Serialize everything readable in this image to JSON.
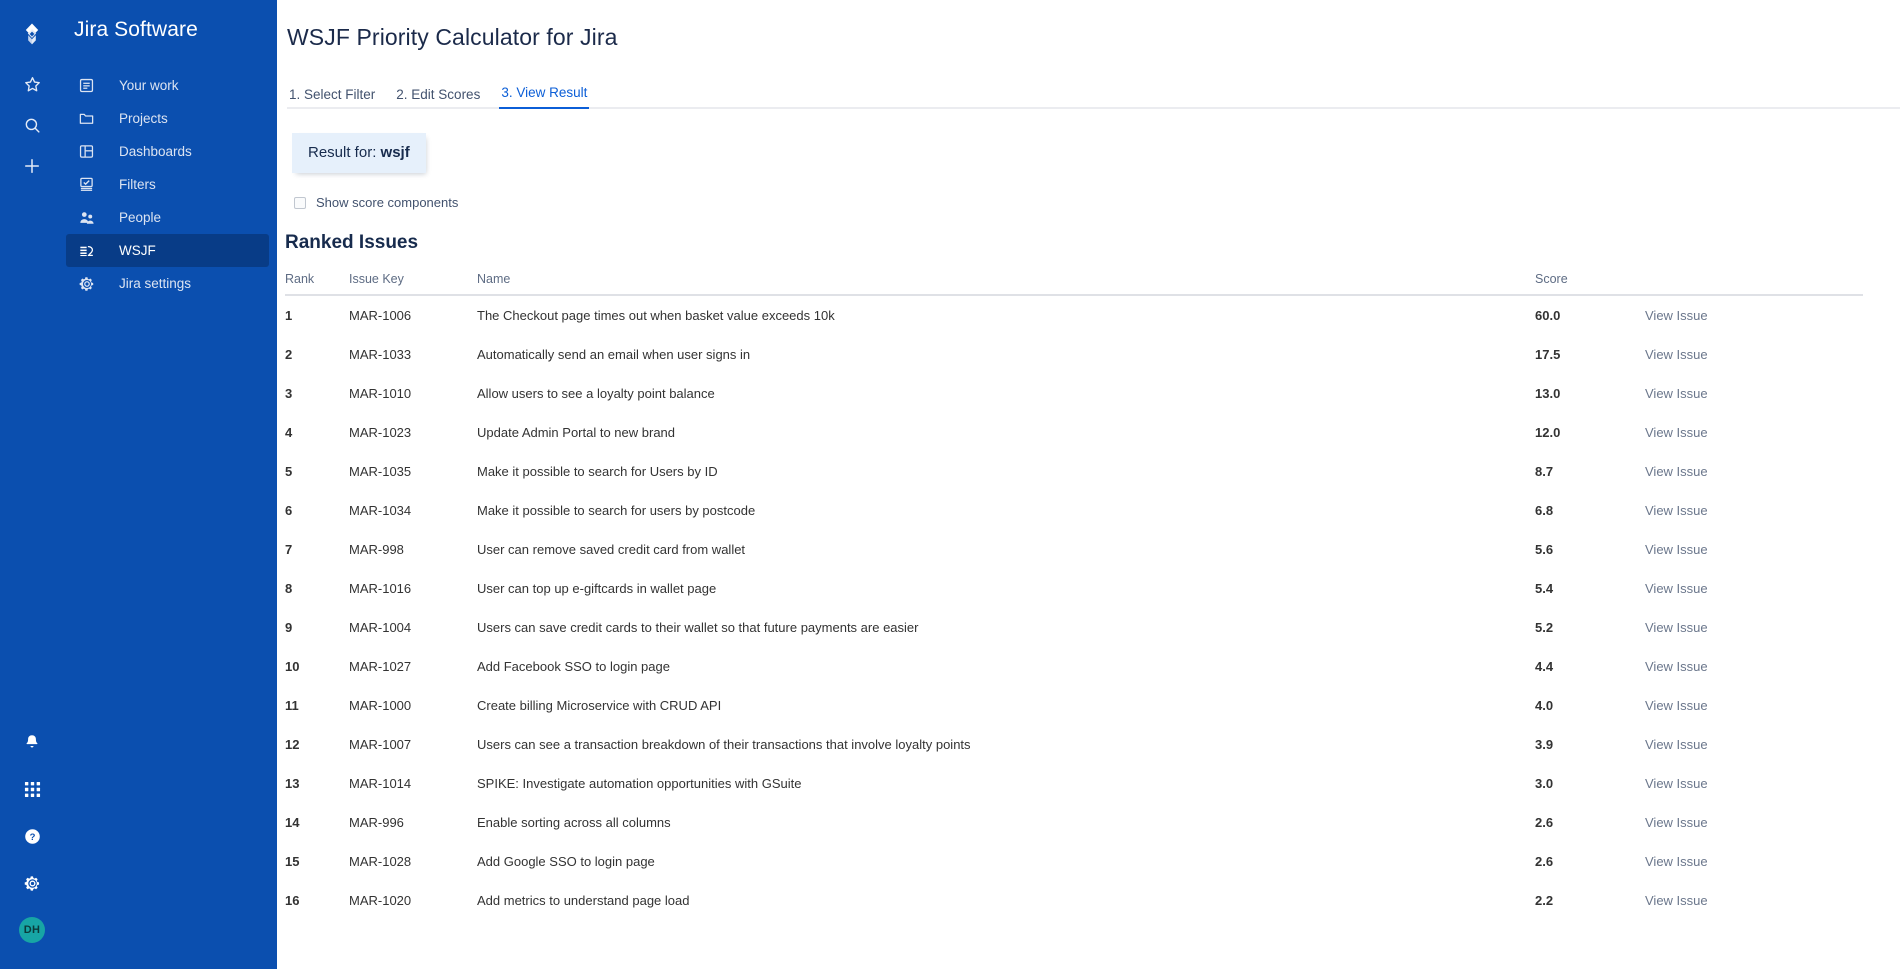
{
  "rail": {
    "icons": [
      {
        "name": "jira-logo-icon",
        "label": "Jira"
      },
      {
        "name": "star-icon",
        "label": "Starred"
      },
      {
        "name": "search-icon",
        "label": "Search"
      },
      {
        "name": "plus-icon",
        "label": "Create"
      }
    ],
    "bottom_icons": [
      {
        "name": "notification-bell-icon",
        "label": "Notifications"
      },
      {
        "name": "app-switcher-grid-icon",
        "label": "Apps"
      },
      {
        "name": "help-question-icon",
        "label": "Help"
      },
      {
        "name": "settings-gear-icon",
        "label": "Settings"
      }
    ],
    "avatar_initials": "DH",
    "avatar_color": "#17A5A5"
  },
  "sidebar": {
    "title": "Jira Software",
    "background_color": "#0B4FAF",
    "active_item_color": "#083C87",
    "items": [
      {
        "label": "Your work",
        "icon": "your-work-icon",
        "active": false
      },
      {
        "label": "Projects",
        "icon": "folder-icon",
        "active": false
      },
      {
        "label": "Dashboards",
        "icon": "dashboard-icon",
        "active": false
      },
      {
        "label": "Filters",
        "icon": "filters-icon",
        "active": false
      },
      {
        "label": "People",
        "icon": "people-icon",
        "active": false
      },
      {
        "label": "WSJF",
        "icon": "wsjf-icon",
        "active": true
      },
      {
        "label": "Jira settings",
        "icon": "settings-gear-icon",
        "active": false
      }
    ]
  },
  "header": {
    "title": "WSJF Priority Calculator for Jira"
  },
  "tabs": [
    {
      "label": "1. Select Filter",
      "active": false
    },
    {
      "label": "2. Edit Scores",
      "active": false
    },
    {
      "label": "3. View Result",
      "active": true
    }
  ],
  "result_chip": {
    "prefix": "Result for: ",
    "value": "wsjf",
    "background_color": "#E6F0FB"
  },
  "options": {
    "show_score_components_label": "Show score components",
    "show_score_components_checked": false
  },
  "table": {
    "section_title": "Ranked Issues",
    "headers": [
      "Rank",
      "Issue Key",
      "Name",
      "Score",
      ""
    ],
    "link_label": "View Issue",
    "rows": [
      {
        "rank": "1",
        "key": "MAR-1006",
        "name": "The Checkout page times out when basket value exceeds 10k",
        "score": "60.0"
      },
      {
        "rank": "2",
        "key": "MAR-1033",
        "name": "Automatically send an email when user signs in",
        "score": "17.5"
      },
      {
        "rank": "3",
        "key": "MAR-1010",
        "name": "Allow users to see a loyalty point balance",
        "score": "13.0"
      },
      {
        "rank": "4",
        "key": "MAR-1023",
        "name": "Update Admin Portal to new brand",
        "score": "12.0"
      },
      {
        "rank": "5",
        "key": "MAR-1035",
        "name": "Make it possible to search for Users by ID",
        "score": "8.7"
      },
      {
        "rank": "6",
        "key": "MAR-1034",
        "name": "Make it possible to search for users by postcode",
        "score": "6.8"
      },
      {
        "rank": "7",
        "key": "MAR-998",
        "name": "User can remove saved credit card from wallet",
        "score": "5.6"
      },
      {
        "rank": "8",
        "key": "MAR-1016",
        "name": "User can top up e-giftcards in wallet page",
        "score": "5.4"
      },
      {
        "rank": "9",
        "key": "MAR-1004",
        "name": "Users can save credit cards to their wallet so that future payments are easier",
        "score": "5.2"
      },
      {
        "rank": "10",
        "key": "MAR-1027",
        "name": "Add Facebook SSO to login page",
        "score": "4.4"
      },
      {
        "rank": "11",
        "key": "MAR-1000",
        "name": "Create billing Microservice with CRUD API",
        "score": "4.0"
      },
      {
        "rank": "12",
        "key": "MAR-1007",
        "name": "Users can see a transaction breakdown of their transactions that involve loyalty points",
        "score": "3.9"
      },
      {
        "rank": "13",
        "key": "MAR-1014",
        "name": "SPIKE: Investigate automation opportunities with GSuite",
        "score": "3.0"
      },
      {
        "rank": "14",
        "key": "MAR-996",
        "name": "Enable sorting across all columns",
        "score": "2.6"
      },
      {
        "rank": "15",
        "key": "MAR-1028",
        "name": "Add Google SSO to login page",
        "score": "2.6"
      },
      {
        "rank": "16",
        "key": "MAR-1020",
        "name": "Add metrics to understand page load",
        "score": "2.2"
      }
    ]
  }
}
